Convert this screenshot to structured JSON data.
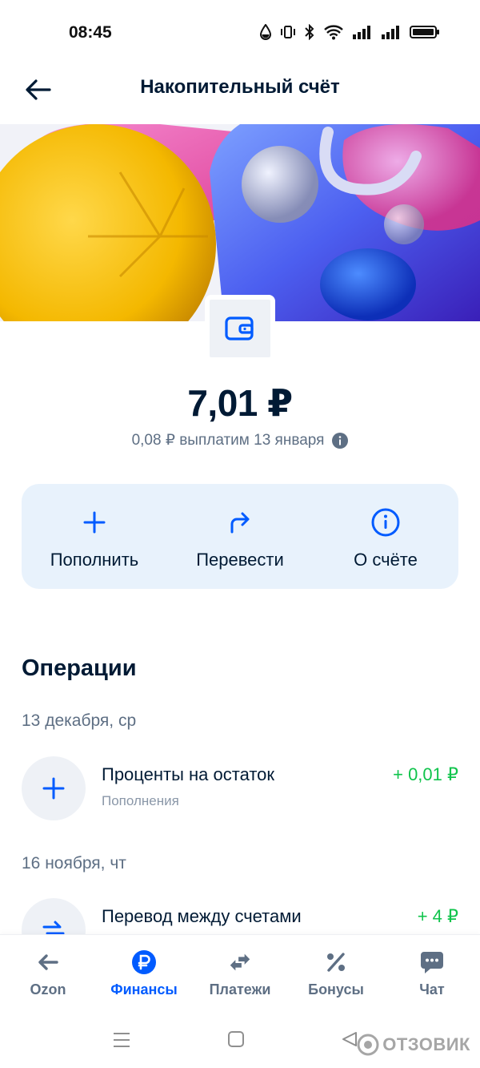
{
  "status_bar": {
    "time": "08:45"
  },
  "header": {
    "title": "Накопительный счёт"
  },
  "account": {
    "balance": "7,01 ₽",
    "payout_text": "0,08 ₽ выплатим 13 января"
  },
  "actions": [
    {
      "label": "Пополнить",
      "icon": "plus-icon"
    },
    {
      "label": "Перевести",
      "icon": "forward-arrow-icon"
    },
    {
      "label": "О счёте",
      "icon": "info-icon"
    }
  ],
  "operations": {
    "title": "Операции",
    "groups": [
      {
        "date": "13 декабря, ср",
        "items": [
          {
            "title": "Проценты на остаток",
            "subtitle": "Пополнения",
            "amount": "+ 0,01 ₽",
            "icon": "plus-icon"
          }
        ]
      },
      {
        "date": "16 ноября, чт",
        "items": [
          {
            "title": "Перевод между счетами",
            "amount": "+ 4 ₽",
            "icon": "transfer-icon"
          }
        ]
      }
    ]
  },
  "bottom_nav": [
    {
      "label": "Ozon",
      "icon": "arrow-left-icon",
      "active": false
    },
    {
      "label": "Финансы",
      "icon": "ruble-icon",
      "active": true
    },
    {
      "label": "Платежи",
      "icon": "exchange-icon",
      "active": false
    },
    {
      "label": "Бонусы",
      "icon": "percent-icon",
      "active": false
    },
    {
      "label": "Чат",
      "icon": "chat-icon",
      "active": false
    }
  ],
  "watermark": "ОТЗОВИК",
  "colors": {
    "accent": "#005bff",
    "positive": "#10c44c",
    "card_bg": "#e8f2fc",
    "text": "#001a34"
  }
}
